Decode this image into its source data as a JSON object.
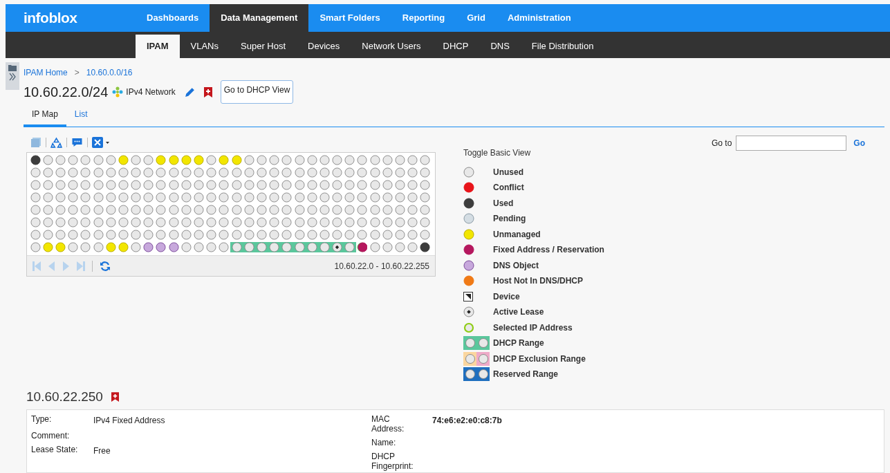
{
  "brand": "infoblox",
  "main_tabs": [
    {
      "label": "Dashboards",
      "selected": false
    },
    {
      "label": "Data Management",
      "selected": true
    },
    {
      "label": "Smart Folders",
      "selected": false
    },
    {
      "label": "Reporting",
      "selected": false
    },
    {
      "label": "Grid",
      "selected": false
    },
    {
      "label": "Administration",
      "selected": false
    }
  ],
  "sub_tabs": [
    {
      "label": "IPAM",
      "selected": true
    },
    {
      "label": "VLANs",
      "selected": false
    },
    {
      "label": "Super Host",
      "selected": false
    },
    {
      "label": "Devices",
      "selected": false
    },
    {
      "label": "Network Users",
      "selected": false
    },
    {
      "label": "DHCP",
      "selected": false
    },
    {
      "label": "DNS",
      "selected": false
    },
    {
      "label": "File Distribution",
      "selected": false
    }
  ],
  "breadcrumb": [
    {
      "label": "IPAM Home"
    },
    {
      "label": ">"
    },
    {
      "label": "10.60.0.0/16"
    }
  ],
  "network": {
    "title": "10.60.22.0/24",
    "type": "IPv4 Network",
    "dhcp_button": "Go to DHCP View"
  },
  "view_tabs": [
    {
      "label": "IP Map",
      "selected": true
    },
    {
      "label": "List",
      "selected": false
    }
  ],
  "goto": {
    "label": "Go to",
    "button": "Go"
  },
  "ip_map": {
    "range_label": "10.60.22.0 - 10.60.22.255",
    "rows": [
      {
        "groups": [
          {
            "kind": "plain",
            "cells": [
              {
                "kind": "used"
              },
              {
                "kind": "unused"
              },
              {
                "kind": "unused"
              },
              {
                "kind": "unused"
              },
              {
                "kind": "unused"
              },
              {
                "kind": "unused"
              },
              {
                "kind": "unused"
              },
              {
                "kind": "unmanaged"
              },
              {
                "kind": "unused"
              },
              {
                "kind": "unused"
              },
              {
                "kind": "unmanaged"
              },
              {
                "kind": "unmanaged"
              },
              {
                "kind": "unmanaged"
              },
              {
                "kind": "unmanaged"
              },
              {
                "kind": "unused"
              },
              {
                "kind": "unmanaged"
              },
              {
                "kind": "unmanaged"
              },
              {
                "kind": "unused"
              },
              {
                "kind": "unused"
              },
              {
                "kind": "unused"
              },
              {
                "kind": "unused"
              },
              {
                "kind": "unused"
              },
              {
                "kind": "unused"
              },
              {
                "kind": "unused"
              },
              {
                "kind": "unused"
              },
              {
                "kind": "unused"
              },
              {
                "kind": "unused"
              },
              {
                "kind": "unused"
              },
              {
                "kind": "unused"
              },
              {
                "kind": "unused"
              },
              {
                "kind": "unused"
              },
              {
                "kind": "unused"
              }
            ]
          }
        ]
      },
      {
        "groups": [
          {
            "kind": "plain",
            "cells": [
              {
                "kind": "unused"
              },
              {
                "kind": "unused"
              },
              {
                "kind": "unused"
              },
              {
                "kind": "unused"
              },
              {
                "kind": "unused"
              },
              {
                "kind": "unused"
              },
              {
                "kind": "unused"
              },
              {
                "kind": "unused"
              },
              {
                "kind": "unused"
              },
              {
                "kind": "unused"
              },
              {
                "kind": "unused"
              },
              {
                "kind": "unused"
              },
              {
                "kind": "unused"
              },
              {
                "kind": "unused"
              },
              {
                "kind": "unused"
              },
              {
                "kind": "unused"
              },
              {
                "kind": "unused"
              },
              {
                "kind": "unused"
              },
              {
                "kind": "unused"
              },
              {
                "kind": "unused"
              },
              {
                "kind": "unused"
              },
              {
                "kind": "unused"
              },
              {
                "kind": "unused"
              },
              {
                "kind": "unused"
              },
              {
                "kind": "unused"
              },
              {
                "kind": "unused"
              },
              {
                "kind": "unused"
              },
              {
                "kind": "unused"
              },
              {
                "kind": "unused"
              },
              {
                "kind": "unused"
              },
              {
                "kind": "unused"
              },
              {
                "kind": "unused"
              }
            ]
          }
        ]
      },
      {
        "groups": [
          {
            "kind": "plain",
            "cells": [
              {
                "kind": "unused"
              },
              {
                "kind": "unused"
              },
              {
                "kind": "unused"
              },
              {
                "kind": "unused"
              },
              {
                "kind": "unused"
              },
              {
                "kind": "unused"
              },
              {
                "kind": "unused"
              },
              {
                "kind": "unused"
              },
              {
                "kind": "unused"
              },
              {
                "kind": "unused"
              },
              {
                "kind": "unused"
              },
              {
                "kind": "unused"
              },
              {
                "kind": "unused"
              },
              {
                "kind": "unused"
              },
              {
                "kind": "unused"
              },
              {
                "kind": "unused"
              },
              {
                "kind": "unused"
              },
              {
                "kind": "unused"
              },
              {
                "kind": "unused"
              },
              {
                "kind": "unused"
              },
              {
                "kind": "unused"
              },
              {
                "kind": "unused"
              },
              {
                "kind": "unused"
              },
              {
                "kind": "unused"
              },
              {
                "kind": "unused"
              },
              {
                "kind": "unused"
              },
              {
                "kind": "unused"
              },
              {
                "kind": "unused"
              },
              {
                "kind": "unused"
              },
              {
                "kind": "unused"
              },
              {
                "kind": "unused"
              },
              {
                "kind": "unused"
              }
            ]
          }
        ]
      },
      {
        "groups": [
          {
            "kind": "plain",
            "cells": [
              {
                "kind": "unused"
              },
              {
                "kind": "unused"
              },
              {
                "kind": "unused"
              },
              {
                "kind": "unused"
              },
              {
                "kind": "unused"
              },
              {
                "kind": "unused"
              },
              {
                "kind": "unused"
              },
              {
                "kind": "unused"
              },
              {
                "kind": "unused"
              },
              {
                "kind": "unused"
              },
              {
                "kind": "unused"
              },
              {
                "kind": "unused"
              },
              {
                "kind": "unused"
              },
              {
                "kind": "unused"
              },
              {
                "kind": "unused"
              },
              {
                "kind": "unused"
              },
              {
                "kind": "unused"
              },
              {
                "kind": "unused"
              },
              {
                "kind": "unused"
              },
              {
                "kind": "unused"
              },
              {
                "kind": "unused"
              },
              {
                "kind": "unused"
              },
              {
                "kind": "unused"
              },
              {
                "kind": "unused"
              },
              {
                "kind": "unused"
              },
              {
                "kind": "unused"
              },
              {
                "kind": "unused"
              },
              {
                "kind": "unused"
              },
              {
                "kind": "unused"
              },
              {
                "kind": "unused"
              },
              {
                "kind": "unused"
              },
              {
                "kind": "unused"
              }
            ]
          }
        ]
      },
      {
        "groups": [
          {
            "kind": "plain",
            "cells": [
              {
                "kind": "unused"
              },
              {
                "kind": "unused"
              },
              {
                "kind": "unused"
              },
              {
                "kind": "unused"
              },
              {
                "kind": "unused"
              },
              {
                "kind": "unused"
              },
              {
                "kind": "unused"
              },
              {
                "kind": "unused"
              },
              {
                "kind": "unused"
              },
              {
                "kind": "unused"
              },
              {
                "kind": "unused"
              },
              {
                "kind": "unused"
              },
              {
                "kind": "unused"
              },
              {
                "kind": "unused"
              },
              {
                "kind": "unused"
              },
              {
                "kind": "unused"
              },
              {
                "kind": "unused"
              },
              {
                "kind": "unused"
              },
              {
                "kind": "unused"
              },
              {
                "kind": "unused"
              },
              {
                "kind": "unused"
              },
              {
                "kind": "unused"
              },
              {
                "kind": "unused"
              },
              {
                "kind": "unused"
              },
              {
                "kind": "unused"
              },
              {
                "kind": "unused"
              },
              {
                "kind": "unused"
              },
              {
                "kind": "unused"
              },
              {
                "kind": "unused"
              },
              {
                "kind": "unused"
              },
              {
                "kind": "unused"
              },
              {
                "kind": "unused"
              }
            ]
          }
        ]
      },
      {
        "groups": [
          {
            "kind": "plain",
            "cells": [
              {
                "kind": "unused"
              },
              {
                "kind": "unused"
              },
              {
                "kind": "unused"
              },
              {
                "kind": "unused"
              },
              {
                "kind": "unused"
              },
              {
                "kind": "unused"
              },
              {
                "kind": "unused"
              },
              {
                "kind": "unused"
              },
              {
                "kind": "unused"
              },
              {
                "kind": "unused"
              },
              {
                "kind": "unused"
              },
              {
                "kind": "unused"
              },
              {
                "kind": "unused"
              },
              {
                "kind": "unused"
              },
              {
                "kind": "unused"
              },
              {
                "kind": "unused"
              },
              {
                "kind": "unused"
              },
              {
                "kind": "unused"
              },
              {
                "kind": "unused"
              },
              {
                "kind": "unused"
              },
              {
                "kind": "unused"
              },
              {
                "kind": "unused"
              },
              {
                "kind": "unused"
              },
              {
                "kind": "unused"
              },
              {
                "kind": "unused"
              },
              {
                "kind": "unused"
              },
              {
                "kind": "unused"
              },
              {
                "kind": "unused"
              },
              {
                "kind": "unused"
              },
              {
                "kind": "unused"
              },
              {
                "kind": "unused"
              },
              {
                "kind": "unused"
              }
            ]
          }
        ]
      },
      {
        "groups": [
          {
            "kind": "plain",
            "cells": [
              {
                "kind": "unused"
              },
              {
                "kind": "unused"
              },
              {
                "kind": "unused"
              },
              {
                "kind": "unused"
              },
              {
                "kind": "unused"
              },
              {
                "kind": "unused"
              },
              {
                "kind": "unused"
              },
              {
                "kind": "unused"
              },
              {
                "kind": "unused"
              },
              {
                "kind": "unused"
              },
              {
                "kind": "unused"
              },
              {
                "kind": "unused"
              },
              {
                "kind": "unused"
              },
              {
                "kind": "unused"
              },
              {
                "kind": "unused"
              },
              {
                "kind": "unused"
              },
              {
                "kind": "unused"
              },
              {
                "kind": "unused"
              },
              {
                "kind": "unused"
              },
              {
                "kind": "unused"
              },
              {
                "kind": "unused"
              },
              {
                "kind": "unused"
              },
              {
                "kind": "unused"
              },
              {
                "kind": "unused"
              },
              {
                "kind": "unused"
              },
              {
                "kind": "unused"
              },
              {
                "kind": "unused"
              },
              {
                "kind": "unused"
              },
              {
                "kind": "unused"
              },
              {
                "kind": "unused"
              },
              {
                "kind": "unused"
              },
              {
                "kind": "unused"
              }
            ]
          }
        ]
      },
      {
        "groups": [
          {
            "kind": "plain",
            "cells": [
              {
                "kind": "unused"
              },
              {
                "kind": "unmanaged"
              },
              {
                "kind": "unmanaged"
              },
              {
                "kind": "unused"
              },
              {
                "kind": "unused"
              },
              {
                "kind": "unused"
              },
              {
                "kind": "unmanaged"
              },
              {
                "kind": "unmanaged"
              },
              {
                "kind": "unused"
              },
              {
                "kind": "dns"
              },
              {
                "kind": "dns"
              },
              {
                "kind": "dns"
              },
              {
                "kind": "unused"
              },
              {
                "kind": "unused"
              },
              {
                "kind": "unused"
              },
              {
                "kind": "unused"
              }
            ]
          },
          {
            "kind": "dhcp",
            "cells": [
              {
                "kind": "unused"
              },
              {
                "kind": "unused"
              },
              {
                "kind": "unused"
              },
              {
                "kind": "unused"
              },
              {
                "kind": "unused"
              },
              {
                "kind": "unused"
              },
              {
                "kind": "unused"
              },
              {
                "kind": "unused"
              },
              {
                "kind": "lease"
              },
              {
                "kind": "unused"
              }
            ]
          },
          {
            "kind": "plain",
            "cells": [
              {
                "kind": "fixed_selected"
              },
              {
                "kind": "unused"
              },
              {
                "kind": "unused"
              },
              {
                "kind": "unused"
              },
              {
                "kind": "unused"
              },
              {
                "kind": "used"
              }
            ]
          }
        ]
      }
    ]
  },
  "legend": {
    "toggle": "Toggle Basic View",
    "items": [
      {
        "kind": "unused",
        "label": "Unused"
      },
      {
        "kind": "conflict",
        "label": "Conflict"
      },
      {
        "kind": "used",
        "label": "Used"
      },
      {
        "kind": "pending",
        "label": "Pending"
      },
      {
        "kind": "unmanaged",
        "label": "Unmanaged"
      },
      {
        "kind": "fixed",
        "label": "Fixed Address / Reservation"
      },
      {
        "kind": "dns",
        "label": "DNS Object"
      },
      {
        "kind": "host",
        "label": "Host Not In DNS/DHCP"
      },
      {
        "kind": "device",
        "label": "Device"
      },
      {
        "kind": "lease",
        "label": "Active Lease"
      },
      {
        "kind": "selected",
        "label": "Selected IP Address"
      },
      {
        "kind": "dhcp_range",
        "label": "DHCP Range"
      },
      {
        "kind": "exclusion_range",
        "label": "DHCP Exclusion Range"
      },
      {
        "kind": "reserved_range",
        "label": "Reserved Range"
      }
    ]
  },
  "details": {
    "title": "10.60.22.250",
    "left": [
      {
        "label": "Type:",
        "value": "IPv4 Fixed Address"
      },
      {
        "label": "Comment:"
      },
      {
        "label": "Lease State:",
        "value": "Free"
      }
    ],
    "right": [
      {
        "label": "MAC Address:",
        "value": "74:e6:e2:e0:c8:7b"
      },
      {
        "label": "Name:"
      },
      {
        "label": "DHCP Fingerprint:"
      }
    ]
  }
}
